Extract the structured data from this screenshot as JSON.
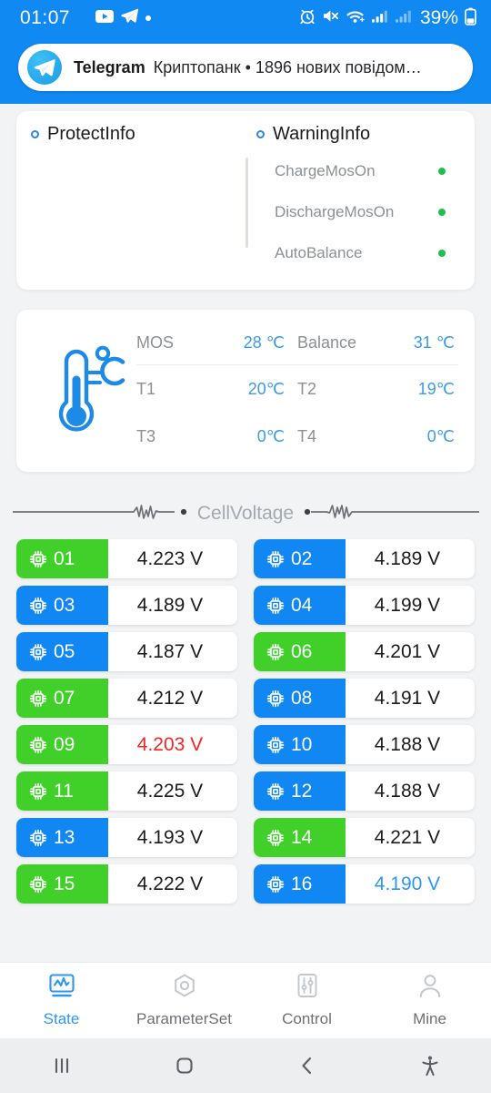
{
  "status_bar": {
    "time": "01:07",
    "battery_percent": "39%",
    "left_icons": [
      "youtube-icon",
      "telegram-icon",
      "dot-icon"
    ],
    "right_icons": [
      "alarm-icon",
      "mute-icon",
      "wifi-icon",
      "signal-icon",
      "signal-icon-2",
      "battery-icon"
    ]
  },
  "notification": {
    "app": "Telegram",
    "message": "Криптопанк • 1896 нових повідом…",
    "logo": "telegram-logo"
  },
  "info_card": {
    "protect": {
      "title": "ProtectInfo",
      "items": []
    },
    "warning": {
      "title": "WarningInfo",
      "items": [
        {
          "label": "ChargeMosOn",
          "status": "ok"
        },
        {
          "label": "DischargeMosOn",
          "status": "ok"
        },
        {
          "label": "AutoBalance",
          "status": "ok"
        }
      ]
    }
  },
  "temperature_card": {
    "icon": "thermometer-celsius-icon",
    "rows": [
      [
        {
          "label": "MOS",
          "value": "28 ℃"
        },
        {
          "label": "Balance",
          "value": "31 ℃"
        }
      ],
      [
        {
          "label": "T1",
          "value": "20℃"
        },
        {
          "label": "T2",
          "value": "19℃"
        }
      ],
      [
        {
          "label": "T3",
          "value": "0℃"
        },
        {
          "label": "T4",
          "value": "0℃"
        }
      ]
    ]
  },
  "cell_voltage": {
    "section_title": "CellVoltage",
    "unit": "V",
    "left": [
      {
        "no": "01",
        "value": "4.223 V",
        "badge": "green",
        "value_color": "black"
      },
      {
        "no": "03",
        "value": "4.189 V",
        "badge": "blue",
        "value_color": "black"
      },
      {
        "no": "05",
        "value": "4.187 V",
        "badge": "blue",
        "value_color": "black"
      },
      {
        "no": "07",
        "value": "4.212 V",
        "badge": "green",
        "value_color": "black"
      },
      {
        "no": "09",
        "value": "4.203 V",
        "badge": "green",
        "value_color": "red"
      },
      {
        "no": "11",
        "value": "4.225 V",
        "badge": "green",
        "value_color": "black"
      },
      {
        "no": "13",
        "value": "4.193 V",
        "badge": "blue",
        "value_color": "black"
      },
      {
        "no": "15",
        "value": "4.222 V",
        "badge": "green",
        "value_color": "black"
      }
    ],
    "right": [
      {
        "no": "02",
        "value": "4.189 V",
        "badge": "blue",
        "value_color": "black"
      },
      {
        "no": "04",
        "value": "4.199 V",
        "badge": "blue",
        "value_color": "black"
      },
      {
        "no": "06",
        "value": "4.201 V",
        "badge": "green",
        "value_color": "black"
      },
      {
        "no": "08",
        "value": "4.191 V",
        "badge": "blue",
        "value_color": "black"
      },
      {
        "no": "10",
        "value": "4.188 V",
        "badge": "blue",
        "value_color": "black"
      },
      {
        "no": "12",
        "value": "4.188 V",
        "badge": "blue",
        "value_color": "black"
      },
      {
        "no": "14",
        "value": "4.221 V",
        "badge": "green",
        "value_color": "black"
      },
      {
        "no": "16",
        "value": "4.190 V",
        "badge": "blue",
        "value_color": "blue"
      }
    ]
  },
  "tabbar": {
    "tabs": [
      {
        "label": "State",
        "icon": "monitor-waveform-icon",
        "active": true
      },
      {
        "label": "ParameterSet",
        "icon": "hex-nut-icon",
        "active": false
      },
      {
        "label": "Control",
        "icon": "sliders-icon",
        "active": false
      },
      {
        "label": "Mine",
        "icon": "person-icon",
        "active": false
      }
    ]
  },
  "android_nav": {
    "buttons": [
      "recents-icon",
      "home-icon",
      "back-icon",
      "accessibility-icon"
    ]
  },
  "colors": {
    "brand_blue": "#1089f3",
    "cell_green": "#41d02a",
    "cell_blue": "#1087f2",
    "value_blue": "#3d9ae8",
    "alert_red": "#f62424",
    "ok_green": "#1fbf4d",
    "muted_text": "#8b8f96",
    "page_bg": "#f2f3f5"
  }
}
